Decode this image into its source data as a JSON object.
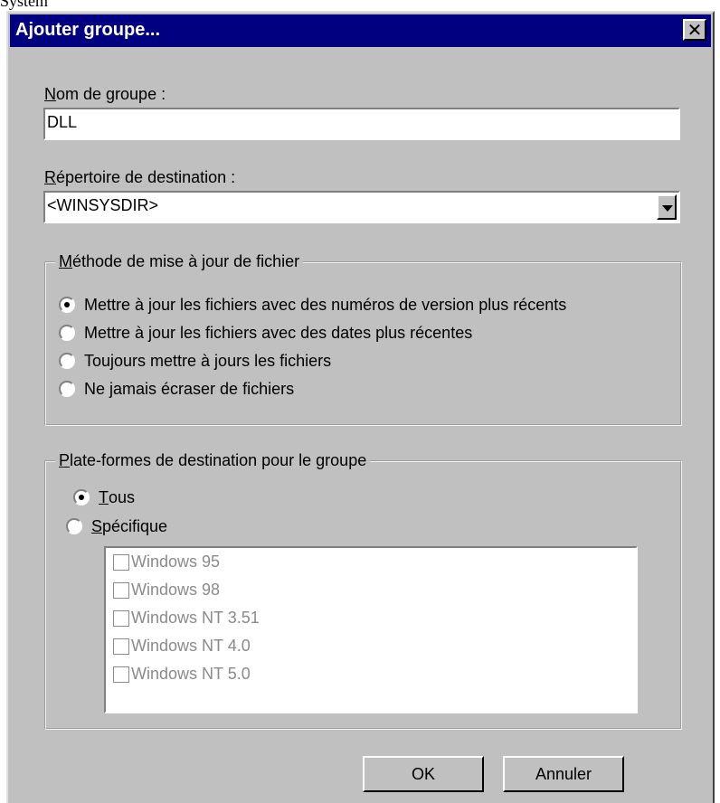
{
  "window_top_text": "System",
  "dialog": {
    "title": "Ajouter groupe...",
    "close_glyph": "✕"
  },
  "group_name": {
    "label_prefix": "N",
    "label_rest": "om de groupe :",
    "value": "DLL"
  },
  "destination": {
    "label_prefix": "R",
    "label_rest": "épertoire de destination :",
    "value": "<WINSYSDIR>"
  },
  "update_method": {
    "legend_prefix": "M",
    "legend_rest": "éthode de mise à jour de fichier",
    "options": [
      {
        "label": "Mettre à jour les fichiers avec des numéros de version plus récents",
        "checked": true
      },
      {
        "label": "Mettre à jour les fichiers avec des dates plus récentes",
        "checked": false
      },
      {
        "label": "Toujours mettre à jours les fichiers",
        "checked": false
      },
      {
        "label": "Ne jamais écraser de fichiers",
        "checked": false
      }
    ]
  },
  "platforms": {
    "legend_prefix": "P",
    "legend_rest": "late-formes de destination pour le groupe",
    "all_prefix": "T",
    "all_rest": "ous",
    "specific_prefix": "S",
    "specific_rest": "pécifique",
    "items": [
      "Windows 95",
      "Windows 98",
      "Windows NT 3.51",
      "Windows NT 4.0",
      "Windows NT 5.0"
    ]
  },
  "buttons": {
    "ok": "OK",
    "cancel": "Annuler"
  }
}
